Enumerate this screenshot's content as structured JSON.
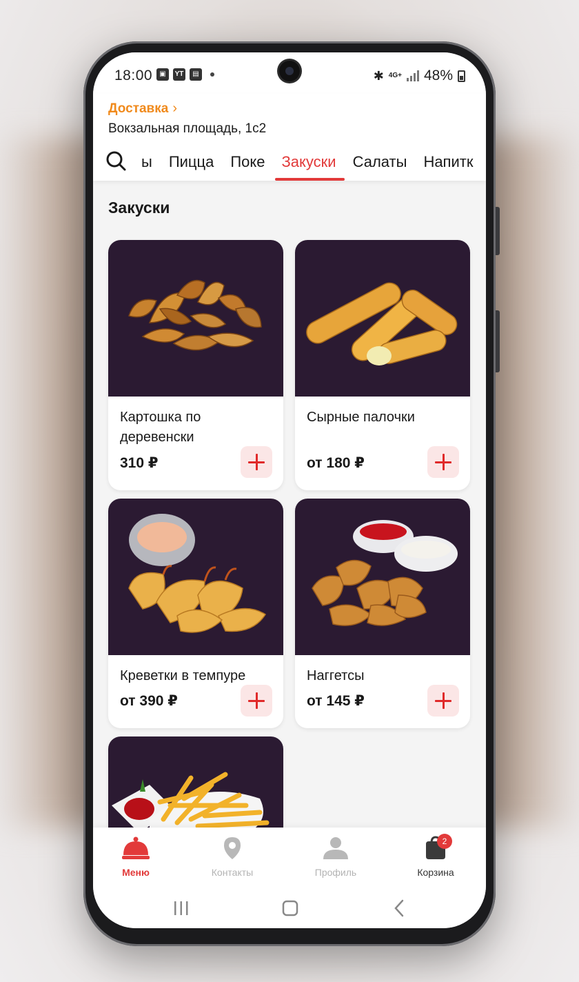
{
  "status_bar": {
    "time": "18:00",
    "network": "4G+",
    "battery": "48%"
  },
  "header": {
    "delivery_label": "Доставка",
    "address": "Вокзальная площадь, 1с2"
  },
  "categories": [
    {
      "label": "ы"
    },
    {
      "label": "Пицца"
    },
    {
      "label": "Поке"
    },
    {
      "label": "Закуски",
      "active": true
    },
    {
      "label": "Салаты"
    },
    {
      "label": "Напитк"
    }
  ],
  "section_title": "Закуски",
  "products": [
    {
      "name": "Картошка по деревенски",
      "price": "310 ₽"
    },
    {
      "name": "Сырные палочки",
      "price": "от 180 ₽"
    },
    {
      "name": "Креветки в темпуре",
      "price": "от 390 ₽"
    },
    {
      "name": "Наггетсы",
      "price": "от 145 ₽"
    }
  ],
  "bottom_nav": {
    "menu": "Меню",
    "contacts": "Контакты",
    "profile": "Профиль",
    "cart": "Корзина",
    "cart_badge": "2"
  },
  "colors": {
    "accent": "#e23a3a",
    "delivery": "#f08a1c",
    "card_image_bg": "#2b1a32"
  }
}
